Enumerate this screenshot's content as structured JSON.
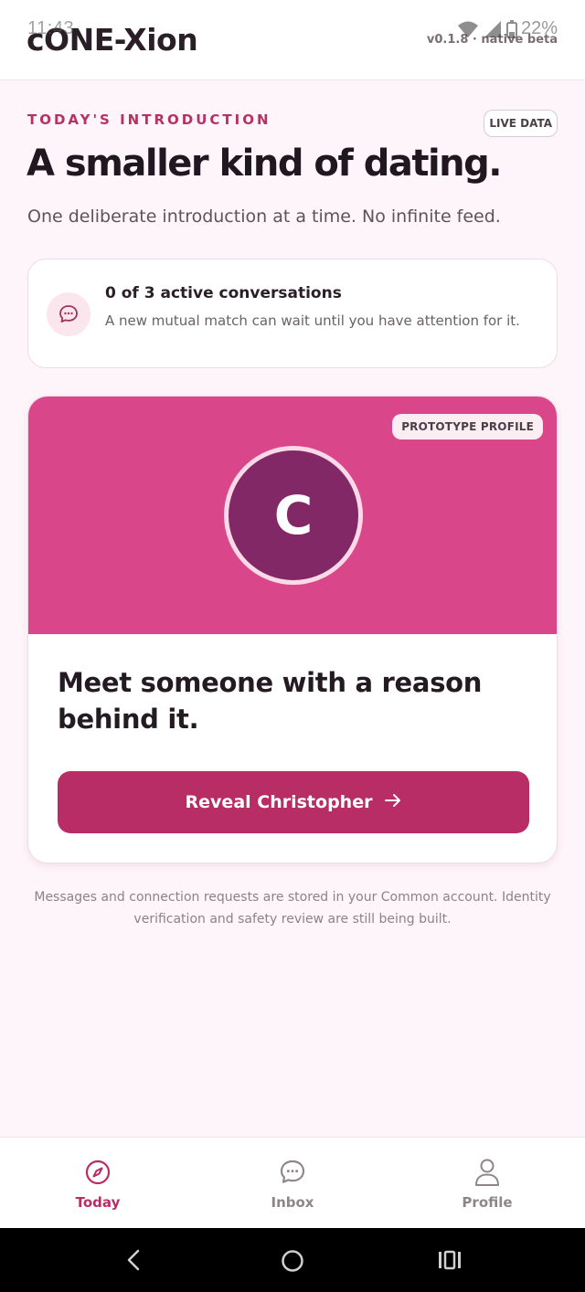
{
  "status_bar": {
    "time": "11:43",
    "battery": "22%"
  },
  "header": {
    "app_title": "cONE-Xion",
    "version": "v0.1.8 · native beta"
  },
  "intro_section": {
    "eyebrow": "TODAY'S INTRODUCTION",
    "live_badge": "LIVE DATA",
    "headline": "A smaller kind of dating.",
    "subhead": "One deliberate introduction at a time. No infinite feed."
  },
  "notice": {
    "icon": "chat-bubble-icon",
    "title": "0 of 3 active conversations",
    "body": "A new mutual match can wait until you have attention for it."
  },
  "intro_card": {
    "badge": "PROTOTYPE PROFILE",
    "avatar_initial": "C",
    "title": "Meet someone with a reason behind it.",
    "button_label": "Reveal Christopher",
    "button_icon": "arrow-right-icon"
  },
  "footnote": "Messages and connection requests are stored in your Common account. Identity verification and safety review are still being built.",
  "bottom_nav": {
    "items": [
      {
        "label": "Today",
        "icon": "compass-icon",
        "active": true
      },
      {
        "label": "Inbox",
        "icon": "chat-bubble-icon",
        "active": false
      },
      {
        "label": "Profile",
        "icon": "user-icon",
        "active": false
      }
    ]
  },
  "colors": {
    "accent": "#b82d66",
    "hero": "#d9478a",
    "avatar": "#832866",
    "background": "#fdf5f9"
  }
}
